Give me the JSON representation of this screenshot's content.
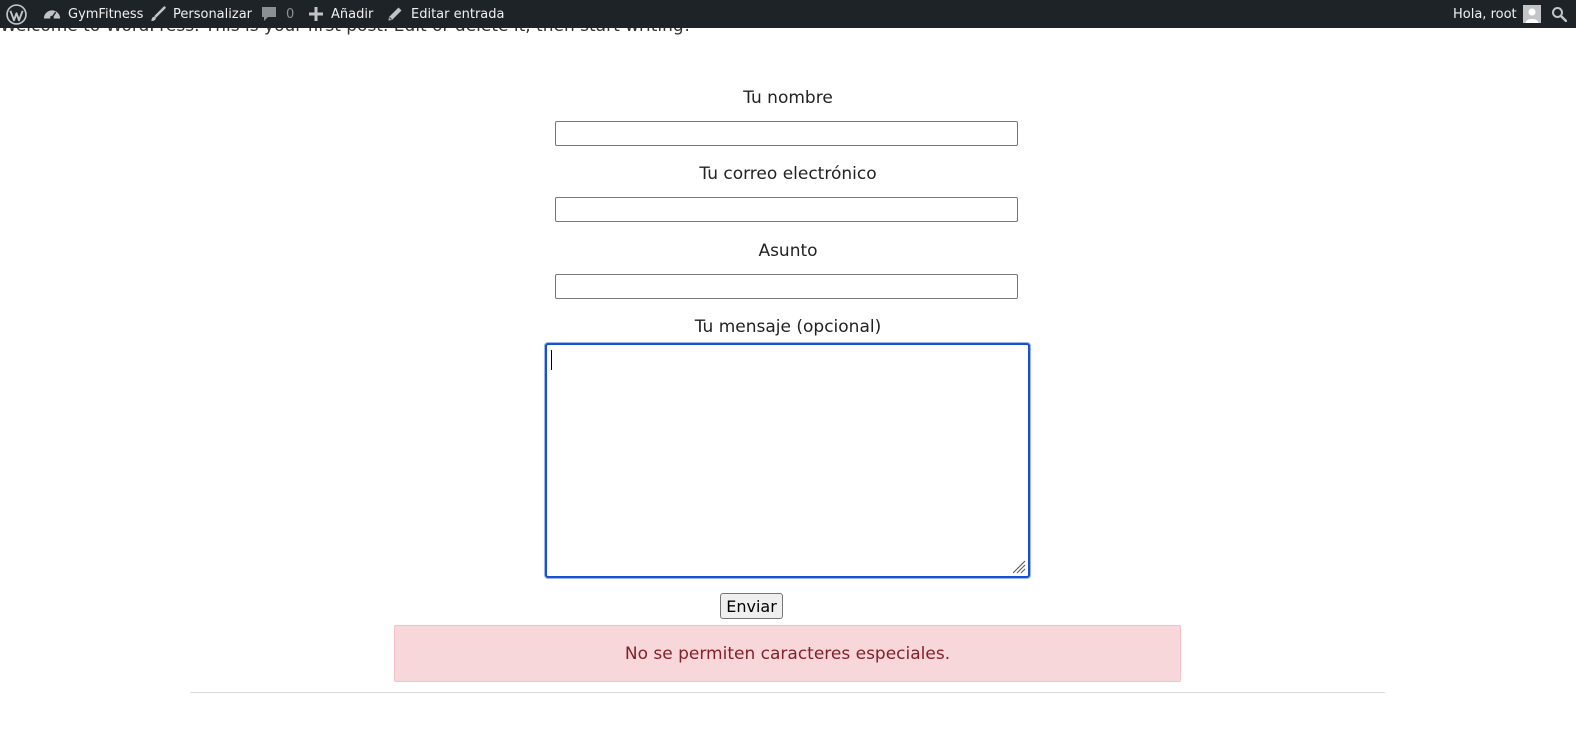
{
  "adminbar": {
    "wp_logo_icon": "wordpress-logo-icon",
    "site_name": "GymFitness",
    "customize_label": "Personalizar",
    "comments_count": "0",
    "new_label": "Añadir",
    "edit_label": "Editar entrada",
    "greeting": "Hola, root",
    "search_icon": "search-icon"
  },
  "post": {
    "text": "Welcome to WordPress. This is your first post. Edit or delete it, then start writing!"
  },
  "form": {
    "name_label": "Tu nombre",
    "name_value": "",
    "email_label": "Tu correo electrónico",
    "email_value": "",
    "subject_label": "Asunto",
    "subject_value": "",
    "message_label": "Tu mensaje (opcional)",
    "message_value": "",
    "submit_label": "Enviar"
  },
  "alert": {
    "message": "No se permiten caracteres especiales.",
    "background": "#f8d7da",
    "text_color": "#842029"
  }
}
